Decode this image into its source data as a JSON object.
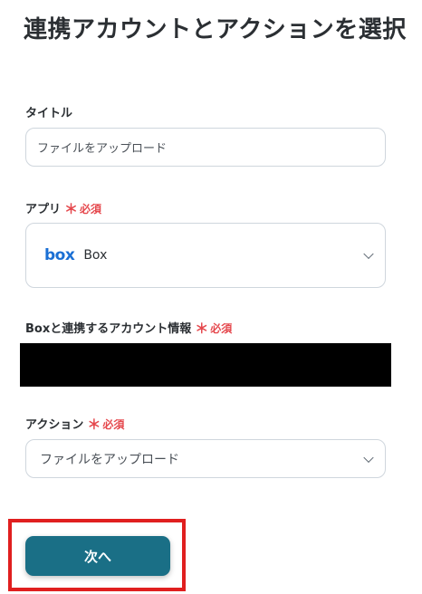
{
  "page": {
    "title": "連携アカウントとアクションを選択"
  },
  "title_field": {
    "label": "タイトル",
    "value": "ファイルをアップロード"
  },
  "app_field": {
    "label": "アプリ",
    "required_text": "必須",
    "required_mark": "＊",
    "logo_text": "box",
    "selected_value": "Box",
    "icon": "chevron-down-icon"
  },
  "account_field": {
    "label": "Boxと連携するアカウント情報",
    "required_text": "必須",
    "required_mark": "＊"
  },
  "action_field": {
    "label": "アクション",
    "required_text": "必須",
    "required_mark": "＊",
    "selected_value": "ファイルをアップロード",
    "icon": "chevron-down-icon"
  },
  "footer": {
    "next_label": "次へ"
  },
  "colors": {
    "accent": "#1a6f86",
    "required": "#e5484d",
    "highlight": "#e01f1f",
    "box_brand": "#1a6fd4"
  }
}
